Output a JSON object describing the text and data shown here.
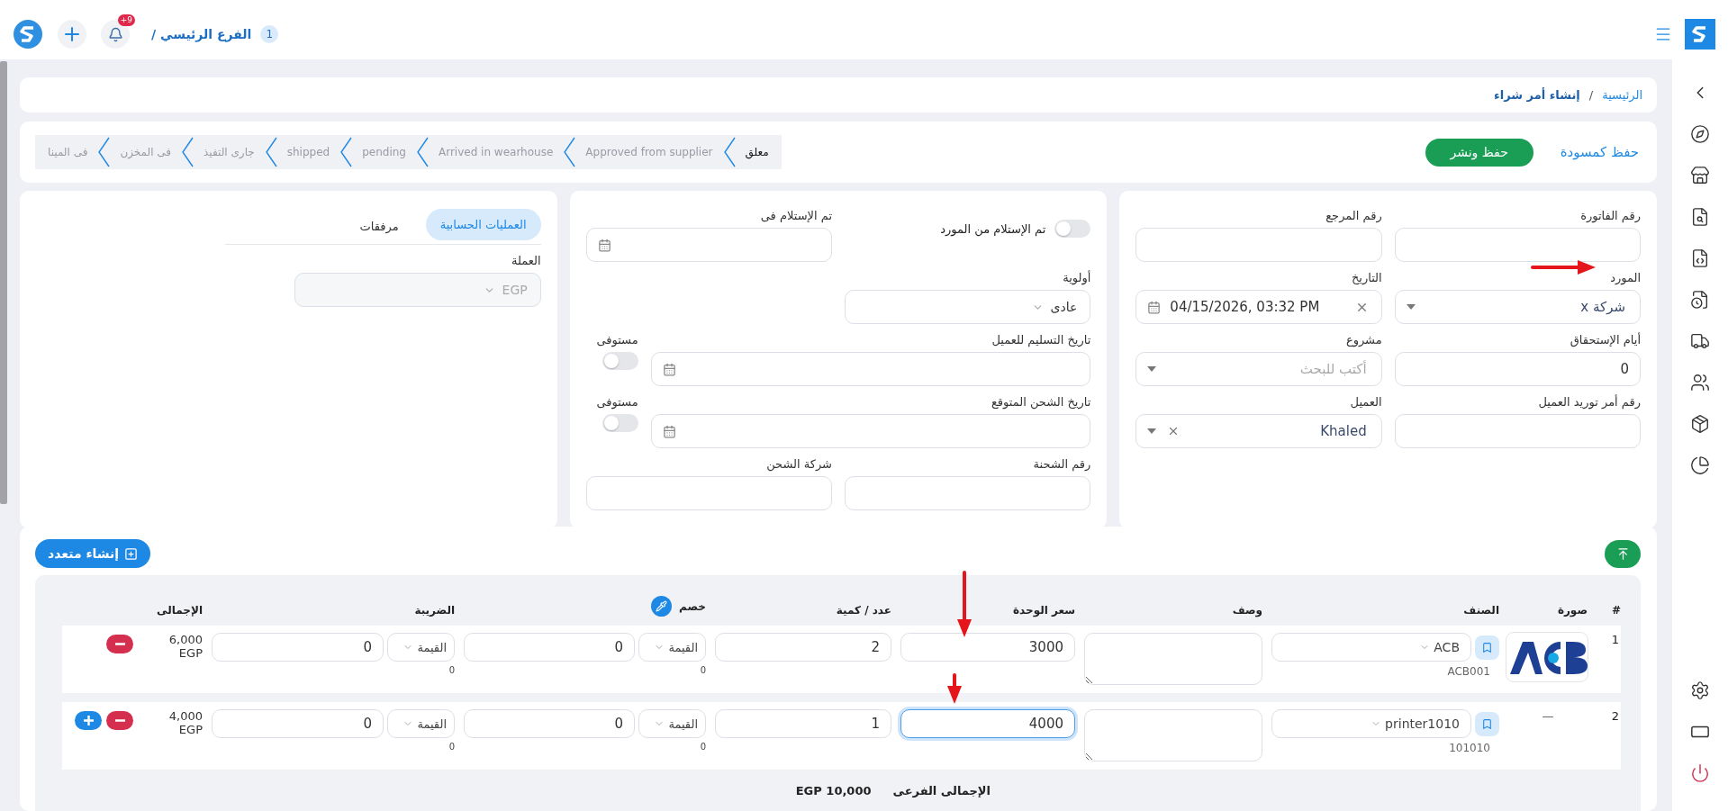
{
  "topbar": {
    "branch_count": "1",
    "branch": "الفرع الرئيسي /",
    "notification_count": "+9"
  },
  "breadcrumb": {
    "separator": "/",
    "items": [
      {
        "label": "الرئيسية",
        "current": false
      },
      {
        "label": "إنشاء أمر شراء",
        "current": true
      }
    ]
  },
  "actions": {
    "draft": "حفظ كمسودة",
    "publish": "حفظ ونشر"
  },
  "stages": [
    {
      "label": "معلق",
      "selected": true
    },
    {
      "label": "Approved from supplier",
      "selected": false
    },
    {
      "label": "Arrived in wearhouse",
      "selected": false
    },
    {
      "label": "pending",
      "selected": false
    },
    {
      "label": "shipped",
      "selected": false
    },
    {
      "label": "جارى التفيذ",
      "selected": false
    },
    {
      "label": "فى المخزن",
      "selected": false
    },
    {
      "label": "فى المينا",
      "selected": false
    }
  ],
  "order_fields": [
    {
      "kind": "text",
      "label": "رقم الفاتورة"
    },
    {
      "kind": "text",
      "label": "رقم المرجع"
    },
    {
      "kind": "select",
      "label": "المورد",
      "value": "شركة x",
      "clearable": false
    },
    {
      "kind": "date",
      "label": "التاريخ",
      "value": "04/15/2026, 03:32 PM",
      "clearable": true
    },
    {
      "kind": "text",
      "label": "أيام الإستحقاق",
      "value": "0"
    },
    {
      "kind": "select",
      "label": "مشروع",
      "placeholder": "أكتب للبحث",
      "clearable": false
    },
    {
      "kind": "text",
      "label": "رقم أمر توريد العميل"
    },
    {
      "kind": "select",
      "label": "العميل",
      "value": "Khaled",
      "clearable": true
    }
  ],
  "shipping_rows": [
    {
      "fields": [
        {
          "kind": "switch",
          "label": "تم الإستلام من المورد",
          "on": false
        },
        {
          "kind": "date",
          "label": "تم الإستلام فى",
          "clearable": false
        }
      ]
    },
    {
      "fields": [
        {
          "kind": "dropdown",
          "label": "أولوية",
          "value": "عادى",
          "disabled": false
        }
      ]
    },
    {
      "fields": [
        {
          "kind": "date_status",
          "label": "تاريخ التسليم للعميل",
          "status": "مستوفى",
          "on": false
        }
      ]
    },
    {
      "fields": [
        {
          "kind": "date_status",
          "label": "تاريخ الشحن المتوقع",
          "status": "مستوفى",
          "on": false
        }
      ]
    },
    {
      "fields": [
        {
          "kind": "text",
          "label": "رقم الشحنة"
        },
        {
          "kind": "text",
          "label": "شركة الشحن"
        }
      ]
    }
  ],
  "finance": {
    "tabs": [
      {
        "label": "العمليات الحسابية",
        "selected": true
      },
      {
        "label": "مرفقات",
        "selected": false
      }
    ],
    "fields": [
      {
        "kind": "dropdown",
        "label": "العملة",
        "value": "EGP",
        "disabled": true
      }
    ]
  },
  "items": {
    "create_multiple": "إنشاء متعدد",
    "columns": [
      {
        "label": "#",
        "kind": "plain"
      },
      {
        "label": "صورة",
        "kind": "plain"
      },
      {
        "label": "الصنف",
        "kind": "plain"
      },
      {
        "label": "وصف",
        "kind": "plain"
      },
      {
        "label": "سعر الوحدة",
        "kind": "plain"
      },
      {
        "label": "عدد / كمية",
        "kind": "plain"
      },
      {
        "label": "خصم",
        "kind": "tool"
      },
      {
        "label": "الضريبة",
        "kind": "plain"
      },
      {
        "label": "الإجمالى",
        "kind": "plain"
      }
    ],
    "rows": [
      {
        "number": "1",
        "image": {
          "kind": "picture"
        },
        "item": "ACB",
        "code": "ACB001",
        "price": "3000",
        "price_focused": false,
        "quantity": "2",
        "discount": {
          "type": "القيمة",
          "value": "0",
          "amount": "0"
        },
        "tax": {
          "type": "القيمة",
          "value": "0",
          "amount": "0"
        },
        "total": "6,000",
        "currency": "EGP",
        "actions": [
          {
            "kind": "remove"
          }
        ]
      },
      {
        "number": "2",
        "image": {
          "kind": "none",
          "text": "—"
        },
        "item": "printer1010",
        "code": "101010",
        "price": "4000",
        "price_focused": true,
        "quantity": "1",
        "discount": {
          "type": "القيمة",
          "value": "0",
          "amount": "0"
        },
        "tax": {
          "type": "القيمة",
          "value": "0",
          "amount": "0"
        },
        "total": "4,000",
        "currency": "EGP",
        "actions": [
          {
            "kind": "remove"
          },
          {
            "kind": "add"
          }
        ]
      }
    ],
    "subtotal": {
      "label": "الإجمالى الفرعى",
      "value": "EGP 10,000"
    }
  }
}
